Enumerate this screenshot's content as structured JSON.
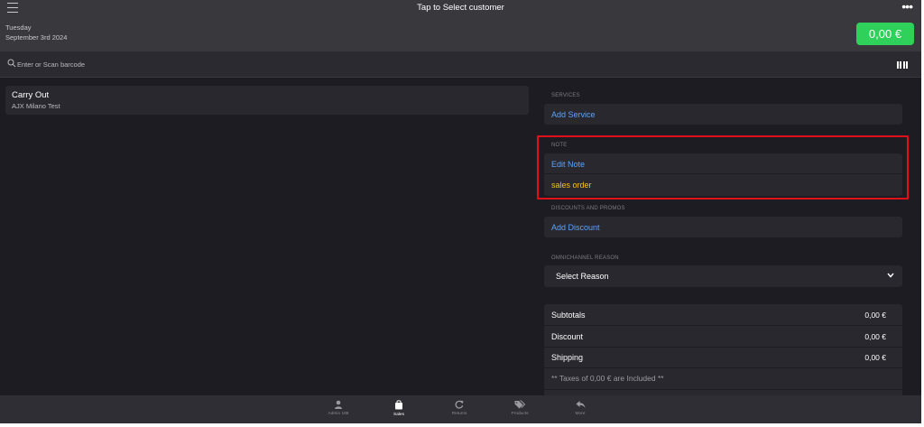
{
  "header": {
    "title": "Tap to Select customer",
    "day": "Tuesday",
    "date": "September 3rd 2024",
    "total": "0,00 €",
    "more_label": "•••"
  },
  "search": {
    "placeholder": "Enter or Scan barcode"
  },
  "order": {
    "title": "Carry Out",
    "subtitle": "AJX Milano Test"
  },
  "services": {
    "label": "SERVICES",
    "action": "Add Service"
  },
  "note": {
    "label": "NOTE",
    "action": "Edit Note",
    "value": "sales order"
  },
  "discounts": {
    "label": "DISCOUNTS AND PROMOS",
    "action": "Add Discount"
  },
  "omnichannel": {
    "label": "OMNICHANNEL REASON",
    "select_value": "Select Reason"
  },
  "totals": {
    "rows": [
      {
        "label": "Subtotals",
        "value": "0,00 €"
      },
      {
        "label": "Discount",
        "value": "0,00 €"
      },
      {
        "label": "Shipping",
        "value": "0,00 €"
      }
    ],
    "taxes_note": "** Taxes of 0,00 € are Included **"
  },
  "tabs": [
    {
      "label": "Admin 188",
      "icon": "person-icon",
      "active": false
    },
    {
      "label": "Sales",
      "icon": "shopping-bag-icon",
      "active": true
    },
    {
      "label": "Returns",
      "icon": "refresh-icon",
      "active": false
    },
    {
      "label": "Products",
      "icon": "tags-icon",
      "active": false
    },
    {
      "label": "More",
      "icon": "reply-icon",
      "active": false
    }
  ],
  "colors": {
    "accent_green": "#2fd15a",
    "link_blue": "#5aa4ff",
    "note_yellow": "#f5c518",
    "highlight_red": "#e0101a"
  }
}
